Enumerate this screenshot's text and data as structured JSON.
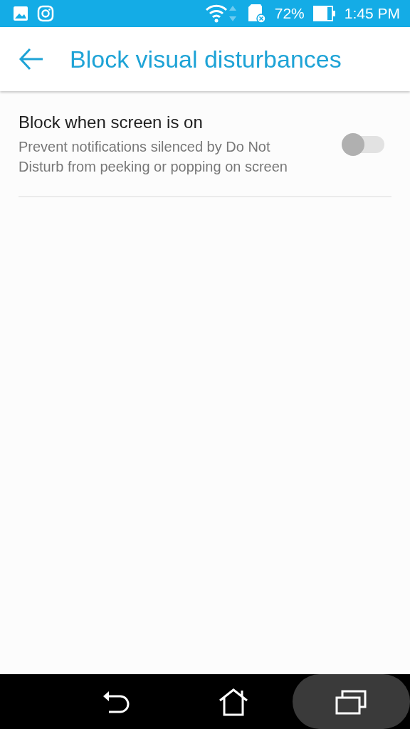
{
  "status_bar": {
    "battery": "72%",
    "time": "1:45 PM"
  },
  "app_bar": {
    "title": "Block visual disturbances"
  },
  "settings": [
    {
      "title": "Block when screen is on",
      "summary": "Prevent notifications silenced by Do Not Disturb from peeking or popping on screen",
      "on": false
    }
  ],
  "nav_bar": [
    {
      "kind": "back",
      "selected": false
    },
    {
      "kind": "home",
      "selected": false
    },
    {
      "kind": "recents",
      "selected": true
    }
  ]
}
